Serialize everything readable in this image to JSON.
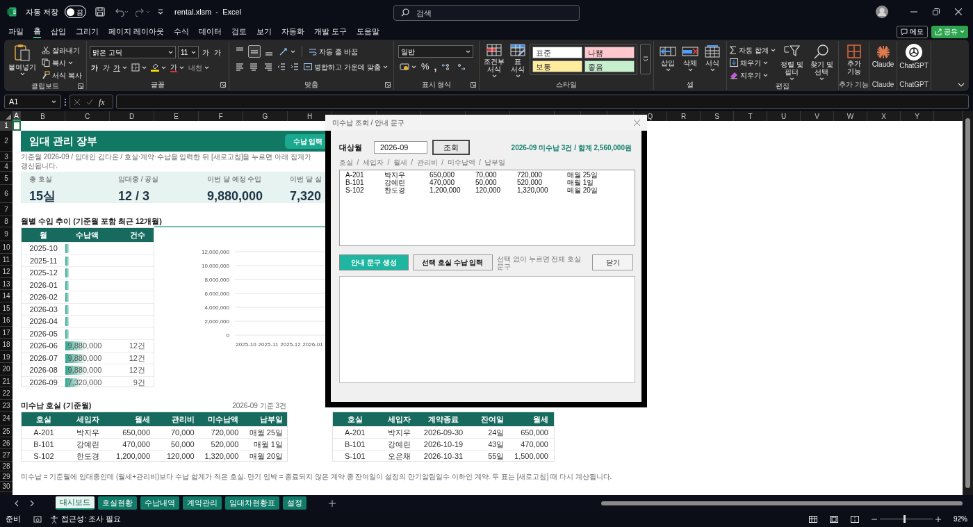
{
  "title_bar": {
    "autosave_label": "자동 저장",
    "autosave": {
      "label": "끔",
      "on": false
    },
    "file_title": "rental.xlsm  -  Excel",
    "search": {
      "placeholder": "검색"
    }
  },
  "menu_tabs": [
    {
      "label": "파일",
      "selected": false
    },
    {
      "label": "홈",
      "selected": true
    },
    {
      "label": "삽입",
      "selected": false
    },
    {
      "label": "그리기",
      "selected": false
    },
    {
      "label": "페이지 레이아웃",
      "selected": false
    },
    {
      "label": "수식",
      "selected": false
    },
    {
      "label": "데이터",
      "selected": false
    },
    {
      "label": "검토",
      "selected": false
    },
    {
      "label": "보기",
      "selected": false
    },
    {
      "label": "자동화",
      "selected": false
    },
    {
      "label": "개발 도구",
      "selected": false
    },
    {
      "label": "도움말",
      "selected": false
    }
  ],
  "memo_button": "메모",
  "share_button": "공유",
  "ribbon": [
    {
      "kind": "clipboard",
      "label": "클립보드",
      "launcher": true,
      "paste": "붙여넣기",
      "cut": "잘라내기",
      "copy": "복사",
      "format_painter": "서식 복사"
    },
    {
      "kind": "font",
      "label": "글꼴",
      "launcher": true,
      "font_name": "맑은 고딕",
      "font_size": "11",
      "grow": "가",
      "shrink": "가",
      "bold": "가",
      "italic": "가",
      "underline": "가",
      "font_color": "가",
      "phonetic": "내천"
    },
    {
      "kind": "alignment",
      "label": "맞춤",
      "launcher": true,
      "vertical": [
        {
          "selected": false
        },
        {
          "selected": true
        },
        {
          "selected": false
        }
      ],
      "wrap": "자동 줄 바꿈",
      "merge": "병합하고 가운데 맞춤"
    },
    {
      "kind": "number",
      "label": "표시 형식",
      "launcher": true,
      "format": "일반",
      "percent": "%",
      "comma": ","
    },
    {
      "kind": "styles",
      "label": "스타일",
      "launcher": false,
      "conditional": "조건부 서식",
      "table": "표 서식",
      "cells": [
        {
          "label": "표준",
          "color": "#ffffff"
        },
        {
          "label": "나쁨",
          "color": "#ffc7ce"
        },
        {
          "label": "보통",
          "color": "#ffeb9c"
        },
        {
          "label": "좋음",
          "color": "#c6efce"
        }
      ]
    },
    {
      "kind": "cells",
      "label": "셀",
      "launcher": false,
      "insert": "삽입",
      "delete": "삭제",
      "format": "서식"
    },
    {
      "kind": "editing",
      "label": "편집",
      "launcher": false,
      "autosum": "자동 합계",
      "fill": "채우기",
      "clear": "지우기",
      "sort": "정렬 및 필터",
      "find": "찾기 및 선택"
    },
    {
      "kind": "addins",
      "label": "추가 기능",
      "launcher": false,
      "button": "추가 기능"
    },
    {
      "kind": "claude",
      "label": "Claude",
      "launcher": false,
      "button": "Claude"
    },
    {
      "kind": "chatgpt",
      "label": "ChatGPT",
      "launcher": false,
      "button": "ChatGPT"
    }
  ],
  "formula_bar": {
    "name_box": "A1",
    "fx": "fx"
  },
  "column_headers": [
    {
      "label": "A",
      "selected": true
    },
    {
      "label": "B",
      "selected": false
    },
    {
      "label": "C",
      "selected": false
    },
    {
      "label": "D",
      "selected": false
    },
    {
      "label": "E",
      "selected": false
    },
    {
      "label": "F",
      "selected": false
    },
    {
      "label": "G",
      "selected": false
    },
    {
      "label": "H",
      "selected": false
    },
    {
      "label": "Q",
      "selected": false
    },
    {
      "label": "R",
      "selected": false
    },
    {
      "label": "S",
      "selected": false
    },
    {
      "label": "T",
      "selected": false
    },
    {
      "label": "U",
      "selected": false
    },
    {
      "label": "V",
      "selected": false
    },
    {
      "label": "W",
      "selected": false
    },
    {
      "label": "X",
      "selected": false
    },
    {
      "label": "Y",
      "selected": false
    }
  ],
  "row_headers": [
    {
      "label": "1",
      "selected": true
    },
    {
      "label": "2",
      "selected": false
    },
    {
      "label": "3",
      "selected": false
    },
    {
      "label": "4",
      "selected": false
    },
    {
      "label": "5",
      "selected": false
    },
    {
      "label": "6",
      "selected": false
    },
    {
      "label": "7",
      "selected": false
    },
    {
      "label": "8",
      "selected": false
    },
    {
      "label": "9",
      "selected": false
    },
    {
      "label": "10",
      "selected": false
    },
    {
      "label": "11",
      "selected": false
    },
    {
      "label": "12",
      "selected": false
    },
    {
      "label": "13",
      "selected": false
    },
    {
      "label": "14",
      "selected": false
    },
    {
      "label": "15",
      "selected": false
    },
    {
      "label": "16",
      "selected": false
    },
    {
      "label": "17",
      "selected": false
    },
    {
      "label": "18",
      "selected": false
    },
    {
      "label": "19",
      "selected": false
    },
    {
      "label": "20",
      "selected": false
    },
    {
      "label": "21",
      "selected": false
    },
    {
      "label": "22",
      "selected": false
    },
    {
      "label": "23",
      "selected": false
    },
    {
      "label": "24",
      "selected": false
    },
    {
      "label": "25",
      "selected": false
    },
    {
      "label": "26",
      "selected": false
    },
    {
      "label": "27",
      "selected": false
    },
    {
      "label": "28",
      "selected": false
    },
    {
      "label": "29",
      "selected": false
    },
    {
      "label": "30",
      "selected": false
    }
  ],
  "dashboard": {
    "title": "임대 관리 장부",
    "pay_button": "수납 입력",
    "subtitle": "기준월 2026-09 / 임대인 김다온 / 호실·계약·수납을 입력한 뒤 [새로고침]을 누르면 아래 집계가 갱신됩니다.",
    "kpis": [
      {
        "label": "총 호실",
        "value": "15실"
      },
      {
        "label": "임대중 / 공실",
        "value": "12 / 3"
      },
      {
        "label": "이번 달 예정 수입",
        "value": "9,880,000"
      },
      {
        "label": "이번 달 실",
        "value": "7,320"
      }
    ],
    "trend_title": "월별 수입 추이 (기준월 포함 최근 12개월)",
    "trend_table": {
      "columns": [
        "월",
        "수납액",
        "건수"
      ],
      "rows": [
        {
          "month": "2025-10"
        },
        {
          "month": "2025-11"
        },
        {
          "month": "2025-12"
        },
        {
          "month": "2026-01"
        },
        {
          "month": "2026-02"
        },
        {
          "month": "2026-03"
        },
        {
          "month": "2026-04"
        },
        {
          "month": "2026-05"
        },
        {
          "month": "2026-06",
          "amount": "9,880,000",
          "count": "12건",
          "level": 0.44
        },
        {
          "month": "2026-07",
          "amount": "9,880,000",
          "count": "12건",
          "level": 0.44
        },
        {
          "month": "2026-08",
          "amount": "9,880,000",
          "count": "12건",
          "level": 0.44
        },
        {
          "month": "2026-09",
          "amount": "7,320,000",
          "count": "9건",
          "level": 0.33
        }
      ]
    },
    "chart_data": {
      "type": "bar",
      "grid": true,
      "categories": [
        "2025-10",
        "2025-11",
        "2025-12",
        "2026-01"
      ],
      "values": [
        0,
        0,
        0,
        0
      ],
      "ylim": [
        0,
        12000000
      ],
      "yticks": [
        {
          "value": 0,
          "label": "0"
        },
        {
          "value": 2000000,
          "label": "2,000,000"
        },
        {
          "value": 4000000,
          "label": "4,000,000"
        },
        {
          "value": 6000000,
          "label": "6,000,000"
        },
        {
          "value": 8000000,
          "label": "8,000,000"
        },
        {
          "value": 10000000,
          "label": "10,000,000"
        },
        {
          "value": 12000000,
          "label": "12,000,000"
        }
      ]
    },
    "unpaid": {
      "title": "미수납 호실 (기준월)",
      "note": "2026-09 기준 3건",
      "columns": [
        "호실",
        "세입자",
        "월세",
        "관리비",
        "미수납액",
        "납부일"
      ],
      "rows": [
        [
          "A-201",
          "박지우",
          "650,000",
          "70,000",
          "720,000",
          "매월 25일"
        ],
        [
          "B-101",
          "강예린",
          "470,000",
          "50,000",
          "520,000",
          "매월 1일"
        ],
        [
          "S-102",
          "한도경",
          "1,200,000",
          "120,000",
          "1,320,000",
          "매월 20일"
        ]
      ]
    },
    "expiring": {
      "columns": [
        "호실",
        "세입자",
        "계약종료",
        "잔여일",
        "월세"
      ],
      "rows": [
        [
          "A-201",
          "박지우",
          "2026-09-30",
          "24일",
          "650,000"
        ],
        [
          "B-101",
          "강예린",
          "2026-10-19",
          "43일",
          "470,000"
        ],
        [
          "S-101",
          "오은채",
          "2026-10-31",
          "55일",
          "1,500,000"
        ]
      ]
    },
    "footnote": "미수납 = 기준월에 임대중인데 (월세+관리비)보다 수납 합계가 적은 호실.  만기 임박 = 종료되지 않은 계약 중 잔여일이 설정의 만기알림일수 이하인 계약.  두 표는 [새로고침] 때 다시 계산됩니다."
  },
  "dialog": {
    "title": "미수납 조회 / 안내 문구",
    "month_label": "대상월",
    "month_value": "2026-09",
    "query_button": "조회",
    "summary": "2026-09 미수납 3건 / 합계 2,560,000원",
    "list_header": "호실  /  세입자  /  월세  /  관리비  /  미수납액  /  납부일",
    "list_rows": [
      [
        "A-201",
        "박지우",
        "650,000",
        "70,000",
        "720,000",
        "매월 25일"
      ],
      [
        "B-101",
        "강예린",
        "470,000",
        "50,000",
        "520,000",
        "매월 1일"
      ],
      [
        "S-102",
        "한도경",
        "1,200,000",
        "120,000",
        "1,320,000",
        "매월 20일"
      ]
    ],
    "generate_button": "안내 문구 생성",
    "pay_button": "선택 호실 수납 입력",
    "hint": "선택 없이 누르면 전체 호실 문구",
    "close_button": "닫기"
  },
  "sheet_tabs": [
    {
      "label": "대시보드",
      "selected": true
    },
    {
      "label": "호실현황",
      "selected": false
    },
    {
      "label": "수납내역",
      "selected": false
    },
    {
      "label": "계약관리",
      "selected": false
    },
    {
      "label": "임대차현황표",
      "selected": false
    },
    {
      "label": "설정",
      "selected": false
    }
  ],
  "status_bar": {
    "ready": "준비",
    "accessibility": "접근성: 조사 필요",
    "zoom": "92%",
    "zoom_slider": {
      "level": 0.45
    }
  }
}
